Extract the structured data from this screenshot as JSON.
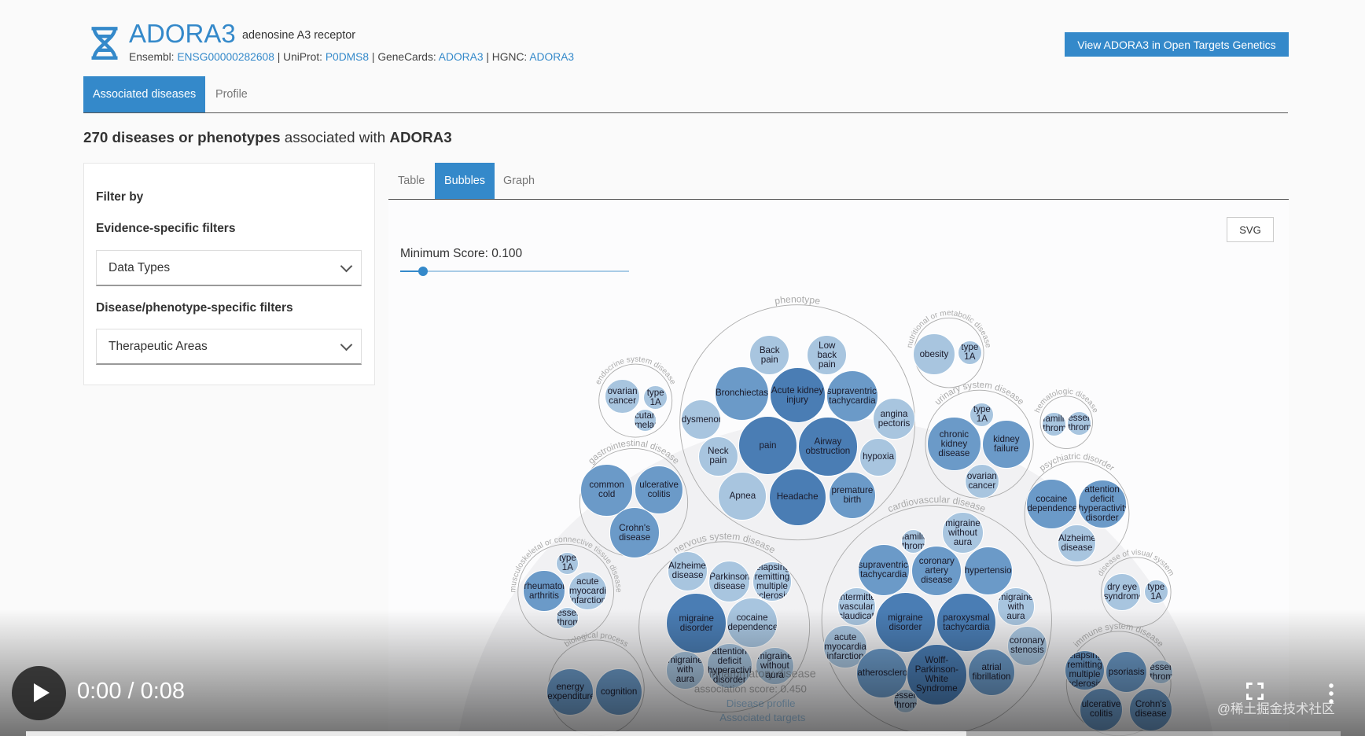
{
  "header": {
    "symbol": "ADORA3",
    "name": "adenosine A3 receptor",
    "ids": [
      {
        "label": "Ensembl:",
        "value": "ENSG00000282608"
      },
      {
        "label": "UniProt:",
        "value": "P0DMS8"
      },
      {
        "label": "GeneCards:",
        "value": "ADORA3"
      },
      {
        "label": "HGNC:",
        "value": "ADORA3"
      }
    ],
    "open_targets_button": "View ADORA3 in Open Targets Genetics"
  },
  "tabs": [
    {
      "label": "Associated diseases",
      "active": true
    },
    {
      "label": "Profile",
      "active": false
    }
  ],
  "summary": {
    "count_text": "270 diseases or phenotypes",
    "rest": " associated with ",
    "target": "ADORA3"
  },
  "filters": {
    "title": "Filter by",
    "evidence_heading": "Evidence-specific filters",
    "data_types": "Data Types",
    "disease_heading": "Disease/phenotype-specific filters",
    "therapeutic_areas": "Therapeutic Areas"
  },
  "view_tabs": [
    {
      "label": "Table",
      "active": false
    },
    {
      "label": "Bubbles",
      "active": true
    },
    {
      "label": "Graph",
      "active": false
    }
  ],
  "svg_button": "SVG",
  "min_score": {
    "label": "Minimum Score: 0.100",
    "value": 0.1
  },
  "colors": {
    "accent": "#3489ca",
    "dark": "#4a7db4",
    "mid": "#6b9ac8",
    "light": "#a8c5df"
  },
  "chart_data": {
    "type": "bubble",
    "groups": [
      {
        "name": "phenotype",
        "items": [
          "Back pain",
          "Low back pain",
          "Bronchiectasis",
          "Acute kidney injury",
          "supraventricular tachycardia",
          "dysmenorrhea",
          "angina pectoris",
          "pain",
          "Airway obstruction",
          "hypoxia",
          "Neck pain",
          "Apnea",
          "Headache",
          "premature birth"
        ]
      },
      {
        "name": "endocrine system disease",
        "items": [
          "ovarian cancer",
          "type 1A",
          "cutaneous melanoma"
        ]
      },
      {
        "name": "gastrointestinal disease",
        "items": [
          "common cold",
          "ulcerative colitis",
          "Crohn's disease"
        ]
      },
      {
        "name": "nutritional or metabolic disease",
        "items": [
          "obesity",
          "type 1A"
        ]
      },
      {
        "name": "urinary system disease",
        "items": [
          "type 1A",
          "chronic kidney disease",
          "kidney failure",
          "ovarian cancer"
        ]
      },
      {
        "name": "hematologic disease",
        "items": [
          "familial thrombocytosis",
          "essential thrombocythemia"
        ]
      },
      {
        "name": "psychiatric disorder",
        "items": [
          "cocaine dependence",
          "attention deficit hyperactivity disorder",
          "Alzheimer's disease"
        ]
      },
      {
        "name": "cardiovascular disease",
        "items": [
          "familial thrombocytosis",
          "migraine without aura",
          "supraventricular tachycardia",
          "coronary artery disease",
          "hypertension",
          "intermittent vascular claudication",
          "migraine with aura",
          "migraine disorder",
          "paroxysmal tachycardia",
          "acute myocardial infarction",
          "coronary stenosis",
          "atherosclerosis",
          "Wolff-Parkinson-White Syndrome",
          "atrial fibrillation",
          "essential thrombocythemia"
        ]
      },
      {
        "name": "nervous system disease",
        "items": [
          "Alzheimer's disease",
          "Parkinson's disease",
          "relapsing-remitting multiple sclerosis",
          "migraine disorder",
          "cocaine dependence",
          "migraine with aura",
          "attention deficit hyperactivity disorder",
          "migraine without aura"
        ]
      },
      {
        "name": "musculoskeletal or connective tissue disease",
        "items": [
          "type 1A",
          "rheumatoid arthritis",
          "acute myocardial infarction",
          "essential thrombocythemia"
        ]
      },
      {
        "name": "disease of visual system",
        "items": [
          "dry eye syndrome",
          "type 1A"
        ]
      },
      {
        "name": "immune system disease",
        "items": [
          "relapsing-remitting multiple sclerosis",
          "psoriasis",
          "essential thrombocythemia",
          "ulcerative colitis",
          "Crohn's disease"
        ]
      },
      {
        "name": "biological process",
        "items": [
          "energy expenditure",
          "cognition"
        ]
      }
    ],
    "tooltip": {
      "title": "inflammatory disease",
      "score": "association score: 0.450",
      "links": [
        "Disease profile",
        "Associated targets"
      ]
    }
  },
  "video": {
    "time": "0:00 / 0:08",
    "watermark": "@稀土掘金技术社区",
    "progress": 0
  }
}
